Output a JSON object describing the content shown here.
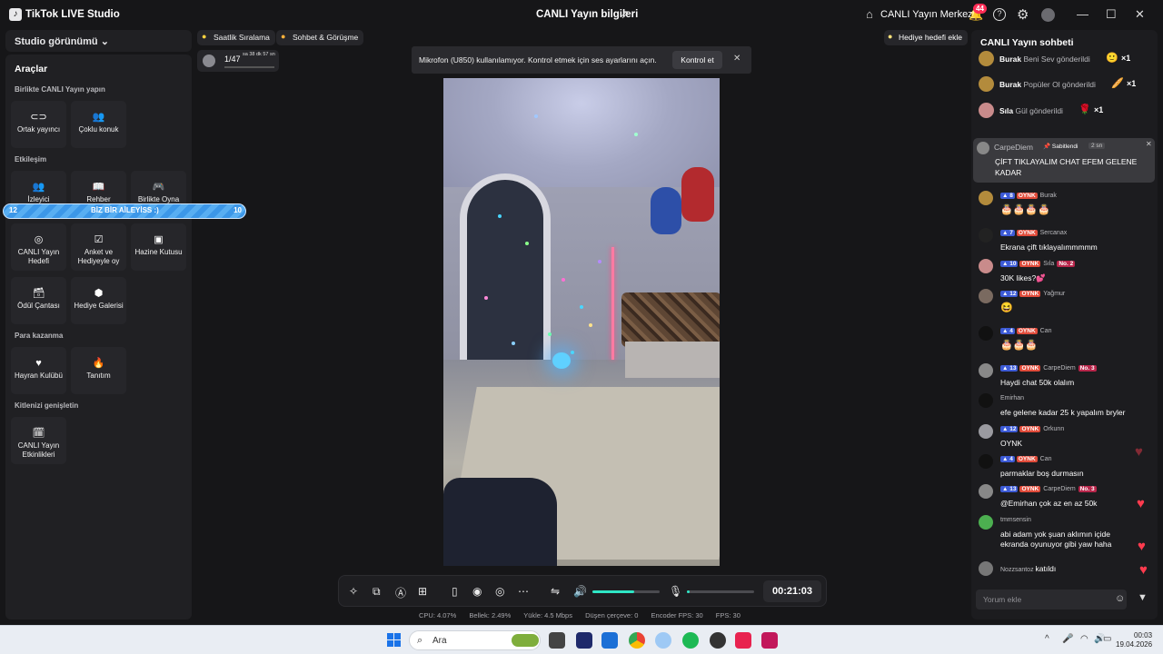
{
  "titlebar": {
    "app_name": "TikTok LIVE Studio",
    "center_title": "CANLI Yayın bilgileri",
    "live_center": "CANLI Yayın Merkezi",
    "notification_count": "44",
    "help_glyph": "?",
    "logo_glyph": "♪",
    "share_glyph": "⇗",
    "home_glyph": "⌂",
    "bell_glyph": "🔔",
    "gear_glyph": "⚙",
    "minimize_glyph": "—",
    "maximize_glyph": "☐",
    "close_glyph": "✕"
  },
  "left": {
    "studio_view": "Studio görünümü ⌄",
    "tools_title": "Araçlar",
    "section_collab": "Birlikte CANLI Yayın yapın",
    "section_engage": "Etkileşim",
    "section_monetize": "Para kazanma",
    "section_expand": "Kitlenizi genişletin",
    "tiles_collab": [
      {
        "icon": "⊂⊃",
        "label": "Ortak yayıncı"
      },
      {
        "icon": "👥",
        "label": "Çoklu konuk"
      }
    ],
    "tiles_engage_row1": [
      {
        "icon": "👥",
        "label": "İzleyici"
      },
      {
        "icon": "📖",
        "label": "Rehber"
      },
      {
        "icon": "🎮",
        "label": "Birlikte Oyna"
      }
    ],
    "tiles_engage_row2": [
      {
        "icon": "◎",
        "label": "CANLI Yayın Hedefi"
      },
      {
        "icon": "☑",
        "label": "Anket ve Hediyeyle oy"
      },
      {
        "icon": "▣",
        "label": "Hazine Kutusu"
      }
    ],
    "tiles_engage_row3": [
      {
        "icon": "🗃",
        "label": "Ödül Çantası"
      },
      {
        "icon": "⬢",
        "label": "Hediye Galerisi"
      }
    ],
    "tiles_monetize": [
      {
        "icon": "♥",
        "label": "Hayran Kulübü"
      },
      {
        "icon": "🔥",
        "label": "Tanıtım"
      }
    ],
    "tiles_expand": [
      {
        "icon": "🗓",
        "label": "CANLI Yayın Etkinlikleri"
      }
    ]
  },
  "goal": {
    "left_value": "12",
    "text": "BİZ BİR AİLEYİSS :)",
    "right_value": "10"
  },
  "top": {
    "hourly_rank": "Saatlik Sıralama",
    "chat_meet": "Sohbet & Görüşme",
    "rank_text": "1/47",
    "rank_time": "sa 38 dk 57 sn",
    "gift_goal": "Hediye hedefi ekle",
    "hourly_rank_icon": "●",
    "chat_meet_icon": "●",
    "gift_goal_icon": "●"
  },
  "notice": {
    "text": "Mikrofon (U850) kullanılamıyor. Kontrol etmek için ses ayarlarını açın.",
    "button": "Kontrol et",
    "close_glyph": "✕"
  },
  "controls": {
    "timer": "00:21:03",
    "volume_level": 0.62,
    "mic_level": 0.04,
    "icons": {
      "magic": "✧",
      "caption": "⧉",
      "ai": "Ⓐ",
      "add_media": "⊞",
      "phone": "▯",
      "record": "◉",
      "snapshot": "◎",
      "more": "⋯",
      "adjust": "⇋",
      "volume": "🔊",
      "mic": "🎙"
    }
  },
  "stats": {
    "cpu": "CPU: 4.07%",
    "memory": "Bellek: 2.49%",
    "upload": "Yükle: 4.5 Mbps",
    "dropped": "Düşen çerçeve: 0",
    "encoder_fps": "Encoder FPS: 30",
    "fps": "FPS: 30"
  },
  "chat": {
    "title": "CANLI Yayın sohbeti",
    "gifts": [
      {
        "user": "Burak",
        "text": "Beni Sev gönderildi",
        "icon": "🙂",
        "count": "×1"
      },
      {
        "user": "Burak",
        "text": "Popüler Ol gönderildi",
        "icon": "🥖",
        "count": "×1"
      },
      {
        "user": "Sıla",
        "text": "Gül gönderildi",
        "icon": "🌹",
        "count": "×1"
      }
    ],
    "pinned": {
      "user": "CarpeDiem",
      "tag": "Sabitlendi",
      "time": "2 sn",
      "message": "ÇİFT TIKLAYALIM CHAT EFEM GELENE KADAR",
      "tag_icon": "📌",
      "close_glyph": "✕"
    },
    "messages": [
      {
        "level": "8",
        "fan": "OYNK",
        "user": "Burak",
        "rank": "",
        "text": "🎂🎂🎂🎂"
      },
      {
        "level": "7",
        "fan": "OYNK",
        "user": "Sercanax",
        "rank": "",
        "text": "Ekrana çift tıklayalımmmmm"
      },
      {
        "level": "10",
        "fan": "OYNK",
        "user": "Sıla",
        "rank": "No. 2",
        "text": "30K likes?💕"
      },
      {
        "level": "12",
        "fan": "OYNK",
        "user": "Yağmur",
        "rank": "",
        "text": "😆"
      },
      {
        "level": "4",
        "fan": "OYNK",
        "user": "Can",
        "rank": "",
        "text": "🎂🎂🎂"
      },
      {
        "level": "13",
        "fan": "OYNK",
        "user": "CarpeDiem",
        "rank": "No. 3",
        "text": "Haydi chat 50k olalım"
      },
      {
        "level": "",
        "fan": "",
        "user": "Emirhan",
        "rank": "",
        "text": "efe gelene kadar 25 k yapalım bryler"
      },
      {
        "level": "12",
        "fan": "OYNK",
        "user": "Orkunn",
        "rank": "",
        "text": "OYNK"
      },
      {
        "level": "4",
        "fan": "OYNK",
        "user": "Can",
        "rank": "",
        "text": "parmaklar boş durmasın"
      },
      {
        "level": "13",
        "fan": "OYNK",
        "user": "CarpeDiem",
        "rank": "No. 3",
        "text": "@Emirhan çok az en az 50k"
      },
      {
        "level": "",
        "fan": "",
        "user": "tmmsensin",
        "rank": "",
        "text": "abi adam yok şuan aklımın içide ekranda oyunuyor gibi yaw haha"
      },
      {
        "level": "",
        "fan": "",
        "user": "Nozzsantoz",
        "rank": "",
        "text": "katıldı"
      }
    ],
    "input_placeholder": "Yorum ekle",
    "emoji_glyph": "☺",
    "filter_glyph": "▼",
    "heart_glyph": "♥"
  },
  "taskbar": {
    "search_text": "Ara",
    "search_glyph": "⌕",
    "tray_glyphs": {
      "chevron": "^",
      "mic": "🎤",
      "wifi": "◠",
      "volume": "🔊",
      "battery": "▭"
    },
    "time": "00:03",
    "date": "19.04.2026"
  }
}
